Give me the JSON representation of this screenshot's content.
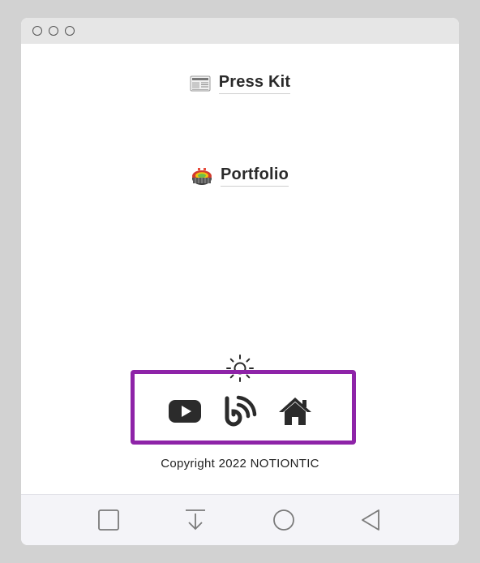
{
  "window": {
    "controls": [
      "window-dot",
      "window-dot",
      "window-dot"
    ]
  },
  "links": [
    {
      "label": "Press Kit",
      "icon": "newspaper-icon"
    },
    {
      "label": "Portfolio",
      "icon": "stadium-icon"
    }
  ],
  "theme_toggle": {
    "icon": "sun-icon"
  },
  "social": [
    {
      "icon": "youtube-icon"
    },
    {
      "icon": "blog-feed-icon"
    },
    {
      "icon": "home-icon"
    }
  ],
  "footer": {
    "copyright": "Copyright 2022 NOTIONTIC"
  },
  "navbar": {
    "buttons": [
      "square-icon",
      "download-icon",
      "circle-icon",
      "back-triangle-icon"
    ]
  },
  "colors": {
    "highlight_border": "#8e23a8",
    "text": "#2a2a2a",
    "background": "#d2d2d2"
  }
}
